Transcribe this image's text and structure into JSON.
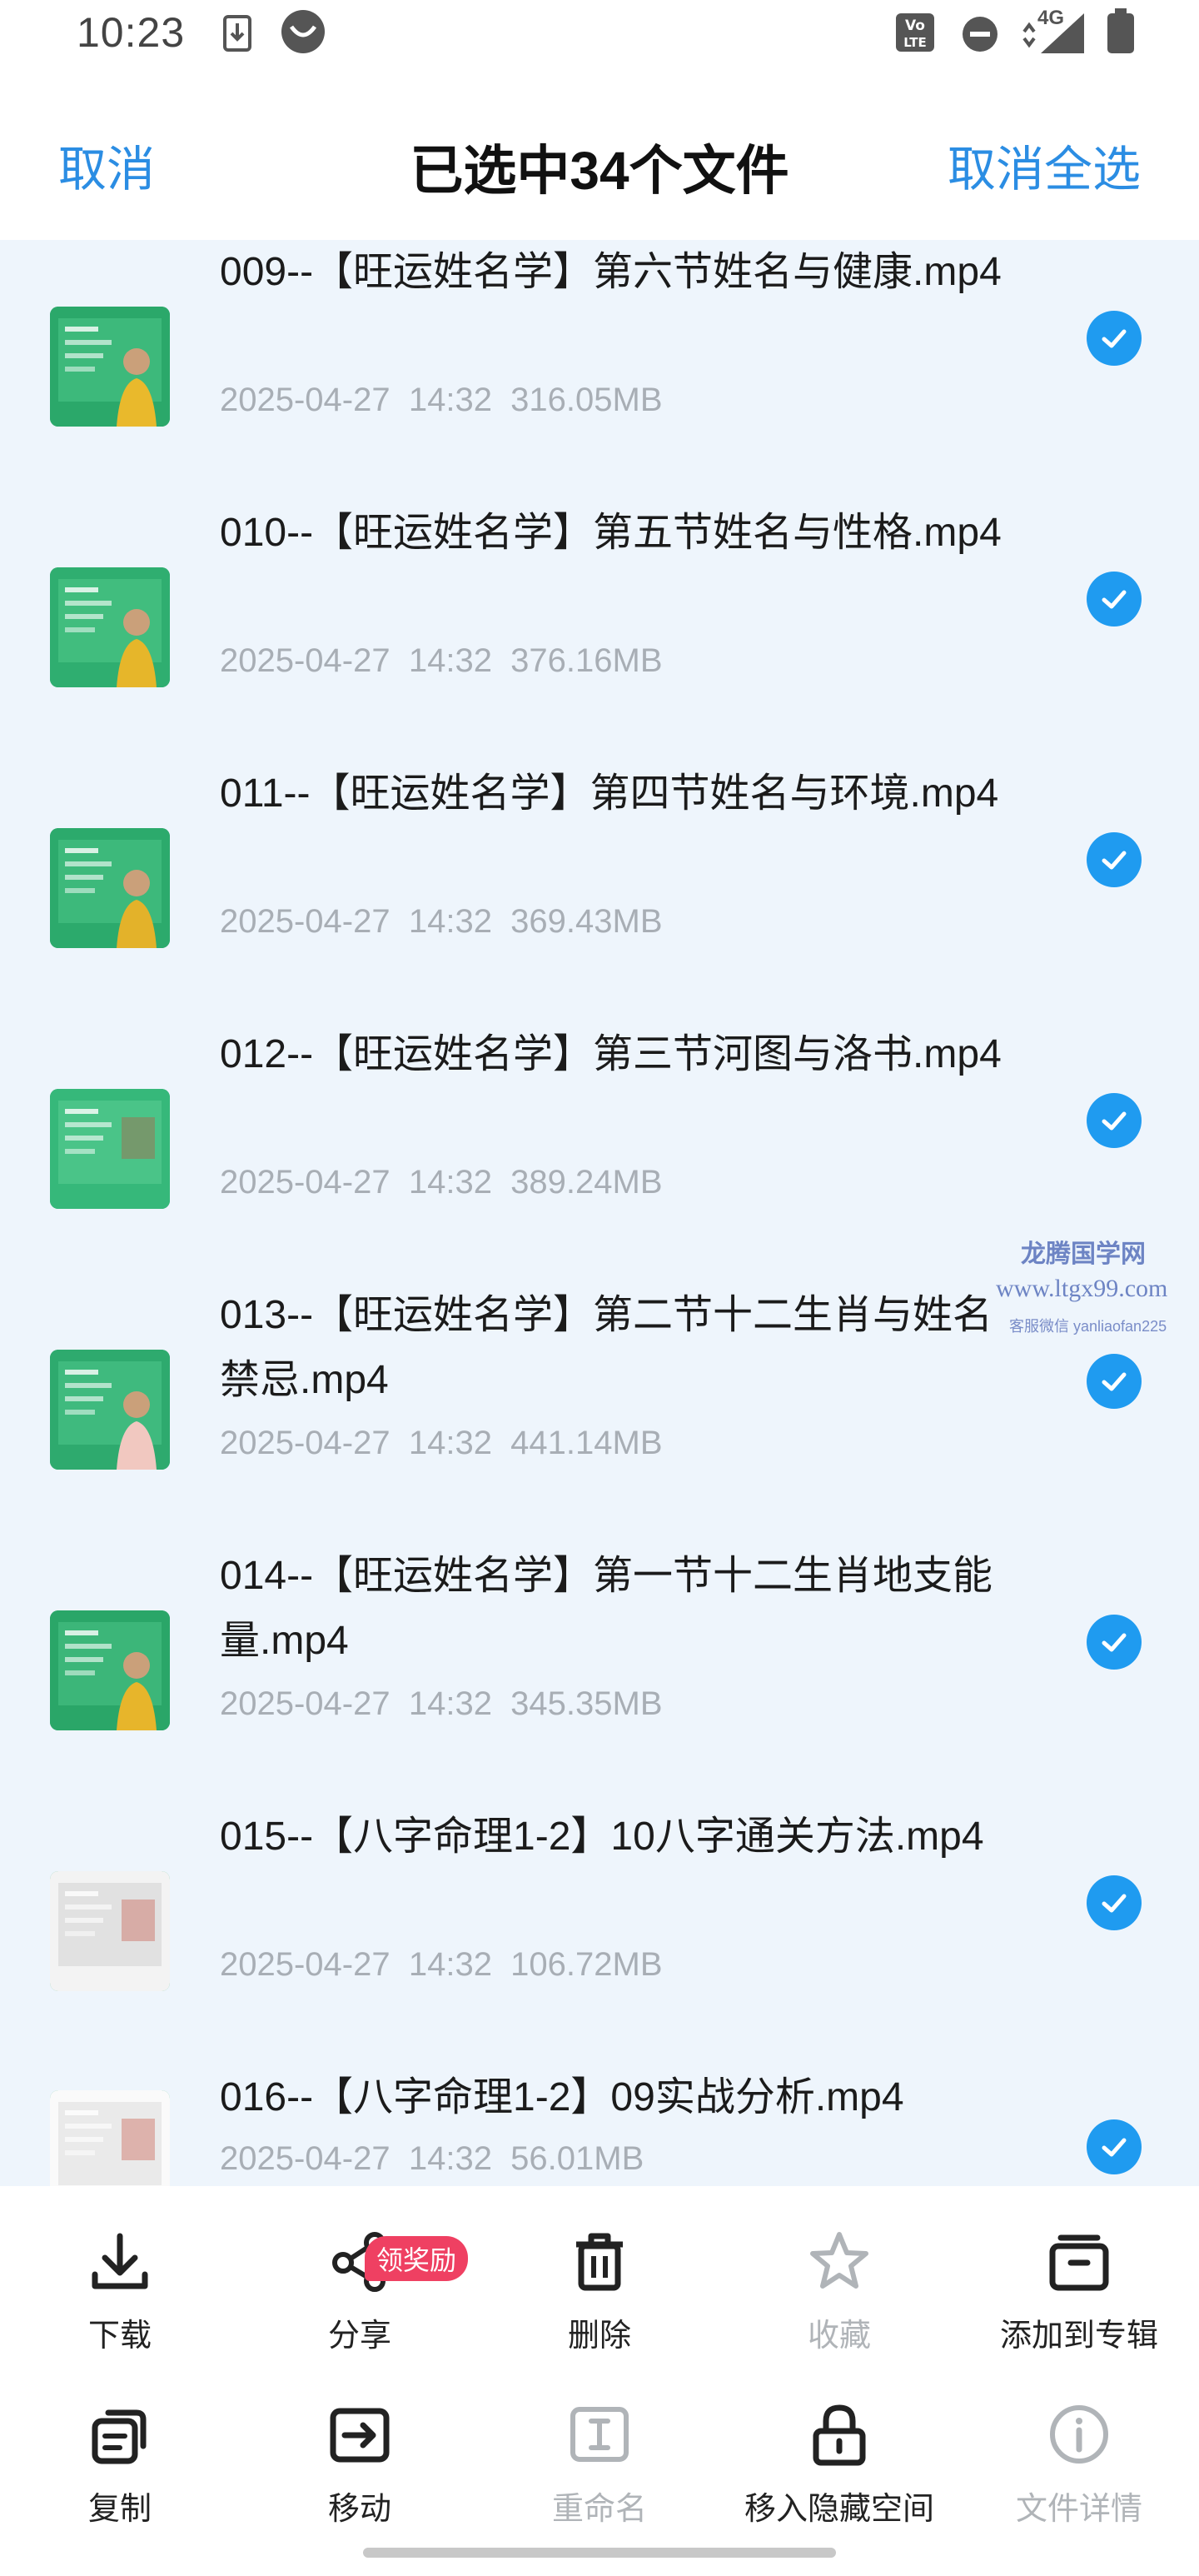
{
  "status_bar": {
    "time": "10:23",
    "network": "4G",
    "icons": [
      "download-notification-icon",
      "app-notification-icon",
      "volte-icon",
      "do-not-disturb-icon",
      "signal-icon",
      "battery-icon"
    ]
  },
  "header": {
    "cancel_label": "取消",
    "title": "已选中34个文件",
    "cancel_all_label": "取消全选"
  },
  "files": [
    {
      "name": "009--【旺运姓名学】第六节姓名与健康.mp4",
      "date": "2025-04-27  14:32",
      "size": "316.05MB",
      "selected": true
    },
    {
      "name": "010--【旺运姓名学】第五节姓名与性格.mp4",
      "date": "2025-04-27  14:32",
      "size": "376.16MB",
      "selected": true
    },
    {
      "name": "011--【旺运姓名学】第四节姓名与环境.mp4",
      "date": "2025-04-27  14:32",
      "size": "369.43MB",
      "selected": true
    },
    {
      "name": "012--【旺运姓名学】第三节河图与洛书.mp4",
      "date": "2025-04-27  14:32",
      "size": "389.24MB",
      "selected": true
    },
    {
      "name": "013--【旺运姓名学】第二节十二生肖与姓名禁忌.mp4",
      "date": "2025-04-27  14:32",
      "size": "441.14MB",
      "selected": true
    },
    {
      "name": "014--【旺运姓名学】第一节十二生肖地支能量.mp4",
      "date": "2025-04-27  14:32",
      "size": "345.35MB",
      "selected": true
    },
    {
      "name": "015--【八字命理1-2】10八字通关方法.mp4",
      "date": "2025-04-27  14:32",
      "size": "106.72MB",
      "selected": true
    },
    {
      "name": "016--【八字命理1-2】09实战分析.mp4",
      "date": "2025-04-27  14:32",
      "size": "56.01MB",
      "selected": true
    }
  ],
  "watermark": {
    "line1": "龙腾国学网",
    "line2": "www.ltgx99.com",
    "line3": "客服微信 yanliaofan225"
  },
  "actions": [
    {
      "label": "下载",
      "icon": "download-icon",
      "enabled": true
    },
    {
      "label": "分享",
      "icon": "share-icon",
      "enabled": true,
      "badge": "领奖励"
    },
    {
      "label": "删除",
      "icon": "trash-icon",
      "enabled": true
    },
    {
      "label": "收藏",
      "icon": "star-icon",
      "enabled": false
    },
    {
      "label": "添加到专辑",
      "icon": "album-icon",
      "enabled": true
    },
    {
      "label": "复制",
      "icon": "copy-icon",
      "enabled": true
    },
    {
      "label": "移动",
      "icon": "move-icon",
      "enabled": true
    },
    {
      "label": "重命名",
      "icon": "rename-icon",
      "enabled": false
    },
    {
      "label": "移入隐藏空间",
      "icon": "lock-icon",
      "enabled": true
    },
    {
      "label": "文件详情",
      "icon": "info-icon",
      "enabled": false
    }
  ],
  "colors": {
    "accent": "#2b8de3",
    "check": "#1f9bf0",
    "list_bg": "#eef5fc",
    "meta_text": "#a8aeb5",
    "badge": "#ef4062"
  }
}
